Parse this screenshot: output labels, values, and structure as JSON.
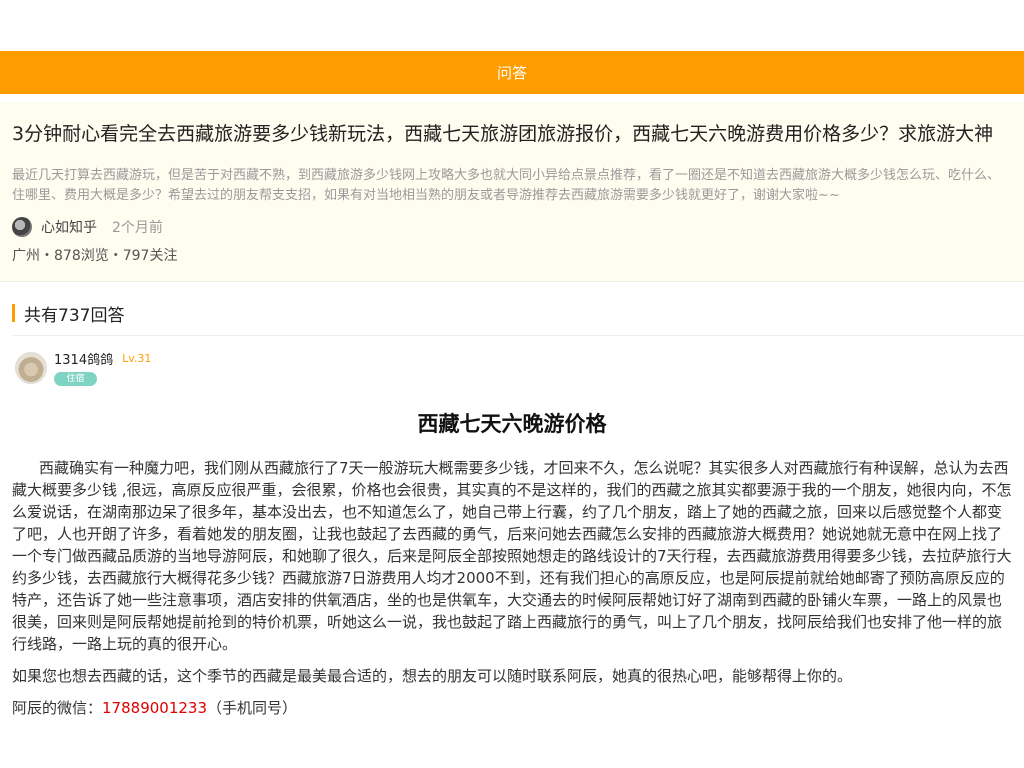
{
  "nav": {
    "title": "问答"
  },
  "question": {
    "title": "3分钟耐心看完全去西藏旅游要多少钱新玩法，西藏七天旅游团旅游报价，西藏七天六晚游费用价格多少？求旅游大神",
    "description": "最近几天打算去西藏游玩，但是苦于对西藏不熟，到西藏旅游多少钱网上攻略大多也就大同小异给点景点推荐，看了一圈还是不知道去西藏旅游大概多少钱怎么玩、吃什么、住哪里、费用大概是多少？希望去过的朋友帮支支招，如果有对当地相当熟的朋友或者导游推荐去西藏旅游需要多少钱就更好了，谢谢大家啦~~",
    "author": "心如知乎",
    "time": "2个月前",
    "stats": "广州・878浏览・797关注"
  },
  "answers_header": "共有737回答",
  "answer": {
    "username": "1314鸽鸽",
    "level": "Lv.31",
    "role": "住宿",
    "title": "西藏七天六晚游价格",
    "body": "西藏确实有一种魔力吧，我们刚从西藏旅行了7天一般游玩大概需要多少钱，才回来不久，怎么说呢？其实很多人对西藏旅行有种误解，总认为去西藏大概要多少钱 ,很远，高原反应很严重，会很累，价格也会很贵，其实真的不是这样的，我们的西藏之旅其实都要源于我的一个朋友，她很内向，不怎么爱说话，在湖南那边呆了很多年，基本没出去，也不知道怎么了，她自己带上行囊，约了几个朋友，踏上了她的西藏之旅，回来以后感觉整个人都变了吧，人也开朗了许多，看着她发的朋友圈，让我也鼓起了去西藏的勇气，后来问她去西藏怎么安排的西藏旅游大概费用？她说她就无意中在网上找了一个专门做西藏品质游的当地导游阿辰，和她聊了很久，后来是阿辰全部按照她想走的路线设计的7天行程，去西藏旅游费用得要多少钱，去拉萨旅行大约多少钱，去西藏旅行大概得花多少钱？西藏旅游7日游费用人均才2000不到，还有我们担心的高原反应，也是阿辰提前就给她邮寄了预防高原反应的特产，还告诉了她一些注意事项，酒店安排的供氧酒店，坐的也是供氧车，大交通去的时候阿辰帮她订好了湖南到西藏的卧铺火车票，一路上的风景也很美，回来则是阿辰帮她提前抢到的特价机票，听她这么一说，我也鼓起了踏上西藏旅行的勇气，叫上了几个朋友，找阿辰给我们也安排了他一样的旅行线路，一路上玩的真的很开心。",
    "p2": "如果您也想去西藏的话，这个季节的西藏是最美最合适的，想去的朋友可以随时联系阿辰，她真的很热心吧，能够帮得上你的。",
    "wechat_label": "阿辰的微信：",
    "wechat_number": "17889001233",
    "wechat_note": "（手机同号）"
  },
  "colors": {
    "accent": "#ff9d00",
    "badge": "#7fd3c3",
    "wechat": "#e00000"
  }
}
